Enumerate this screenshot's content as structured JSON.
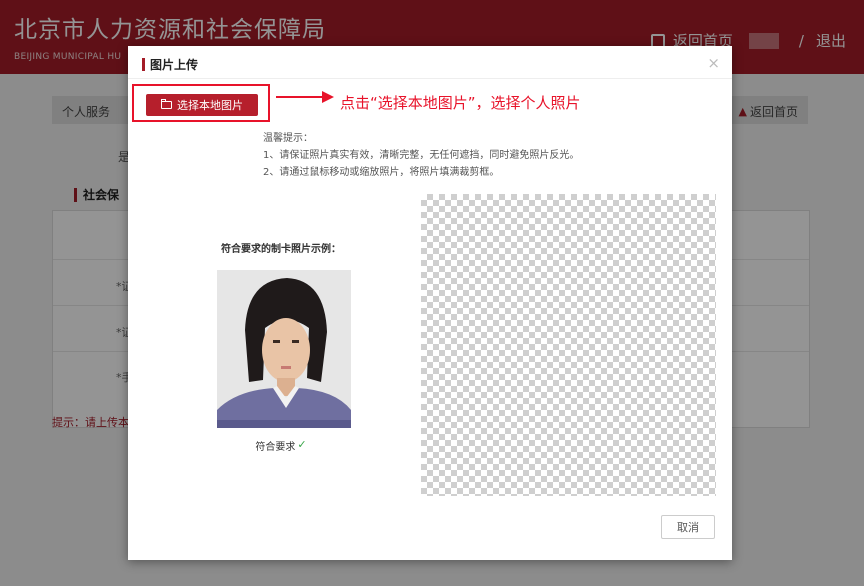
{
  "header": {
    "title": "北京市人力资源和社会保障局",
    "subtitle": "BEIJING MUNICIPAL HU",
    "home_label": "返回首页",
    "separator": "/",
    "logout_label": "退出"
  },
  "breadcrumb": {
    "left": "个人服务",
    "right": "返回首页"
  },
  "background": {
    "leading_char": "是",
    "section_title": "社会保",
    "field_fragment_1": "*证",
    "field_fragment_2": "*证",
    "field_fragment_3": "*手",
    "tip": "提示：请上传本"
  },
  "modal": {
    "title": "图片上传",
    "close_symbol": "×",
    "choose_button": "选择本地图片",
    "annotation": "点击“选择本地图片”，选择个人照片",
    "tips": {
      "heading": "温馨提示：",
      "items": [
        "1、请保证照片真实有效，清晰完整，无任何遮挡，同时避免照片反光。",
        "2、请通过鼠标移动或缩放照片，将照片填满裁剪框。"
      ]
    },
    "sample_title": "符合要求的制卡照片示例：",
    "sample_ok": "符合要求",
    "cancel_button": "取消"
  },
  "colors": {
    "brand": "#a41c28",
    "annotation": "#e8132a",
    "ok": "#3aa64a"
  },
  "icons": {
    "home": "home-icon",
    "house": "house-icon",
    "folder": "folder-icon",
    "close": "close-icon",
    "check": "check-icon"
  }
}
